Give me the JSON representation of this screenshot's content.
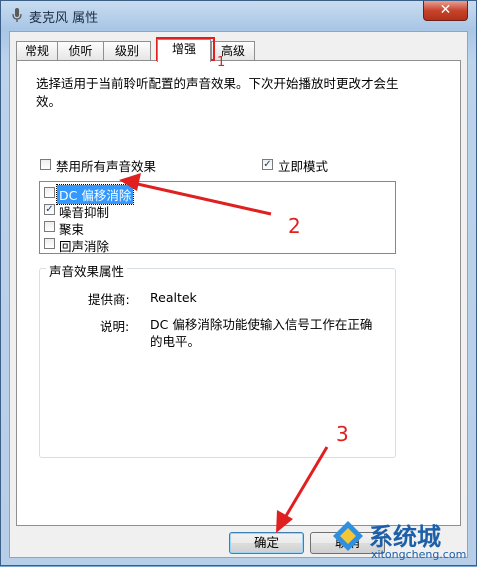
{
  "window": {
    "title": "麦克风 属性",
    "close_glyph": "✕"
  },
  "tabs": [
    {
      "label": "常规",
      "active": false
    },
    {
      "label": "侦听",
      "active": false
    },
    {
      "label": "级别",
      "active": false
    },
    {
      "label": "增强",
      "active": true
    },
    {
      "label": "高级",
      "active": false
    }
  ],
  "enhancements": {
    "description": "选择适用于当前聆听配置的声音效果。下次开始播放时更改才会生效。",
    "disable_all": {
      "label": "禁用所有声音效果",
      "checked": false
    },
    "immediate_mode": {
      "label": "立即模式",
      "checked": true
    },
    "effects": [
      {
        "label": "DC 偏移消除",
        "checked": false,
        "selected": true
      },
      {
        "label": "噪音抑制",
        "checked": true,
        "selected": false
      },
      {
        "label": "聚束",
        "checked": false,
        "selected": false
      },
      {
        "label": "回声消除",
        "checked": false,
        "selected": false
      }
    ],
    "properties": {
      "group_title": "声音效果属性",
      "provider_label": "提供商:",
      "provider_value": "Realtek",
      "desc_label": "说明:",
      "desc_value": "DC 偏移消除功能使输入信号工作在正确的电平。"
    }
  },
  "buttons": {
    "ok": "确定",
    "cancel": "取消"
  },
  "annotations": {
    "step1": "1",
    "step2": "2",
    "step3": "3",
    "color": "#e02020"
  },
  "watermark": {
    "brand": "系统城",
    "url": "xitongcheng.com"
  }
}
